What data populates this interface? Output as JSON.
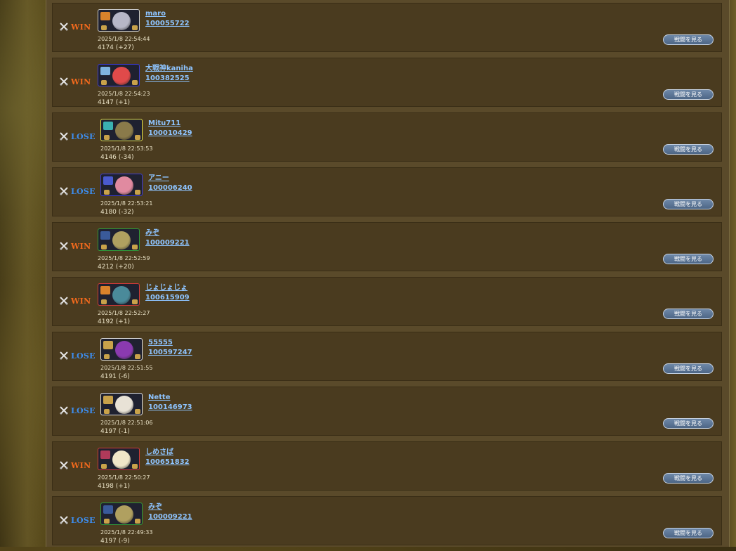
{
  "view_label": "戦闘を見る",
  "battles": [
    {
      "result": "win",
      "label": "WIN",
      "name": "maro",
      "uid": "100055722",
      "time": "2025/1/8 22:54:44",
      "score": "4174 (+27)",
      "frame": "#c9c9c9",
      "badge": "#d9822b",
      "face": "#b7b7c7"
    },
    {
      "result": "win",
      "label": "WIN",
      "name": "大戦神kaniha",
      "uid": "100382525",
      "time": "2025/1/8 22:54:23",
      "score": "4147 (+1)",
      "frame": "#3a3ad0",
      "badge": "#7fb4e0",
      "face": "#e04a4a"
    },
    {
      "result": "lose",
      "label": "LOSE",
      "name": "Mitu711",
      "uid": "100010429",
      "time": "2025/1/8 22:53:53",
      "score": "4146 (-34)",
      "frame": "#e6e24a",
      "badge": "#3ab0b0",
      "face": "#8a7a4a"
    },
    {
      "result": "lose",
      "label": "LOSE",
      "name": "アニー",
      "uid": "100006240",
      "time": "2025/1/8 22:53:21",
      "score": "4180 (-32)",
      "frame": "#3a3ad0",
      "badge": "#4a5ad0",
      "face": "#e08aa0"
    },
    {
      "result": "win",
      "label": "WIN",
      "name": "みぞ",
      "uid": "100009221",
      "time": "2025/1/8 22:52:59",
      "score": "4212 (+20)",
      "frame": "#2f9a3a",
      "badge": "#3a5a9a",
      "face": "#b0a060"
    },
    {
      "result": "win",
      "label": "WIN",
      "name": "じょじょじょ",
      "uid": "100615909",
      "time": "2025/1/8 22:52:27",
      "score": "4192 (+1)",
      "frame": "#d03a3a",
      "badge": "#d9822b",
      "face": "#4a8a9a"
    },
    {
      "result": "lose",
      "label": "LOSE",
      "name": "55555",
      "uid": "100597247",
      "time": "2025/1/8 22:51:55",
      "score": "4191 (-6)",
      "frame": "#e0e0e0",
      "badge": "#c9a24a",
      "face": "#8a3ab0"
    },
    {
      "result": "lose",
      "label": "LOSE",
      "name": "Nette",
      "uid": "100146973",
      "time": "2025/1/8 22:51:06",
      "score": "4197 (-1)",
      "frame": "#e0e0e0",
      "badge": "#c9a24a",
      "face": "#e8e2d6"
    },
    {
      "result": "win",
      "label": "WIN",
      "name": "しめさば",
      "uid": "100651832",
      "time": "2025/1/8 22:50:27",
      "score": "4198 (+1)",
      "frame": "#d03a3a",
      "badge": "#b03a5a",
      "face": "#f0e6c8"
    },
    {
      "result": "lose",
      "label": "LOSE",
      "name": "みぞ",
      "uid": "100009221",
      "time": "2025/1/8 22:49:33",
      "score": "4197 (-9)",
      "frame": "#2f9a3a",
      "badge": "#3a5a9a",
      "face": "#b0a060"
    }
  ]
}
